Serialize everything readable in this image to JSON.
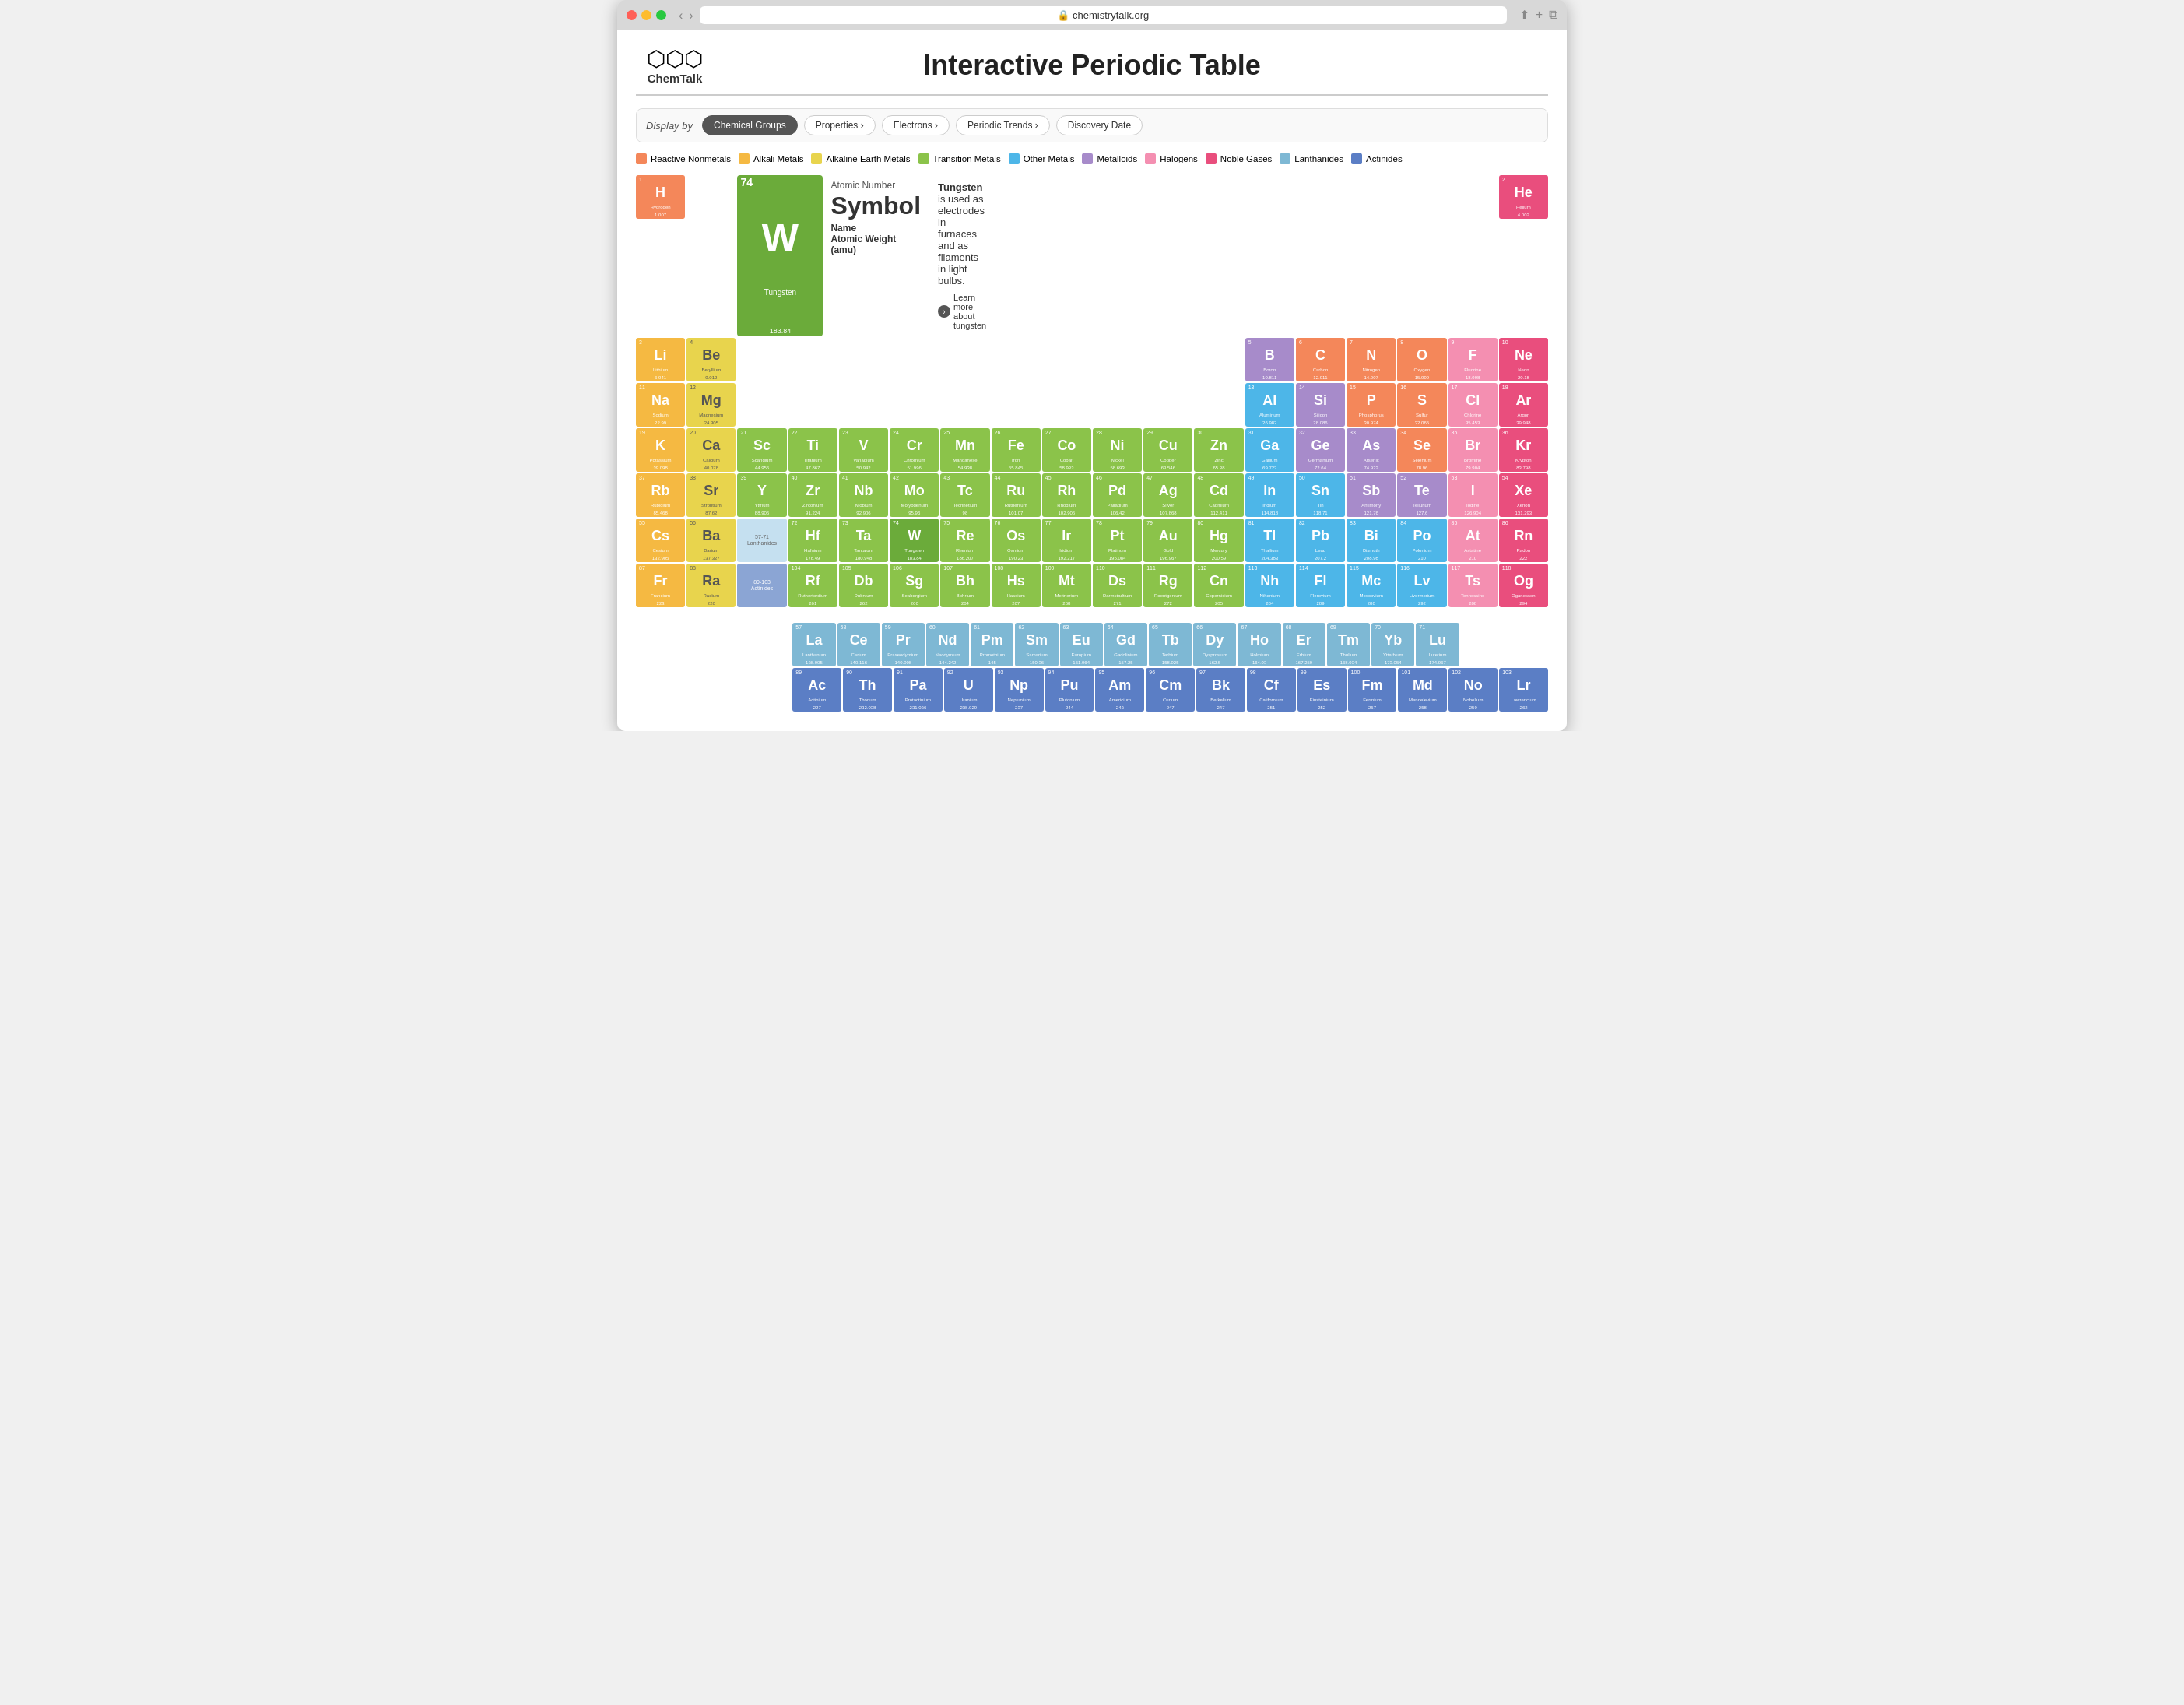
{
  "browser": {
    "url": "chemistrytalk.org",
    "title": "chemistrytalk.org"
  },
  "header": {
    "logo": "ChemTalk",
    "title": "Interactive Periodic Table"
  },
  "display_by": {
    "label": "Display by",
    "filters": [
      "Chemical Groups",
      "Properties >",
      "Electrons >",
      "Periodic Trends >",
      "Discovery Date"
    ]
  },
  "legend": [
    {
      "label": "Reactive Nonmetals",
      "class": "legend-reactive"
    },
    {
      "label": "Alkali Metals",
      "class": "legend-alkali"
    },
    {
      "label": "Alkaline Earth Metals",
      "class": "legend-alkaline"
    },
    {
      "label": "Transition Metals",
      "class": "legend-transition"
    },
    {
      "label": "Other Metals",
      "class": "legend-other"
    },
    {
      "label": "Metalloids",
      "class": "legend-metalloid"
    },
    {
      "label": "Halogens",
      "class": "legend-halogen"
    },
    {
      "label": "Noble Gases",
      "class": "legend-noble"
    },
    {
      "label": "Lanthanides",
      "class": "legend-lanthanide"
    },
    {
      "label": "Actinides",
      "class": "legend-actinide"
    }
  ],
  "selected_element": {
    "number": 74,
    "symbol": "W",
    "name": "Tungsten",
    "weight": "183.84",
    "description": "Tungsten is used as electrodes in furnaces and as filaments in light bulbs.",
    "link_text": "Learn more about tungsten"
  },
  "label_box": {
    "atomic_number": "Atomic Number",
    "symbol": "Symbol",
    "name": "Name",
    "weight": "Atomic Weight (amu)"
  }
}
